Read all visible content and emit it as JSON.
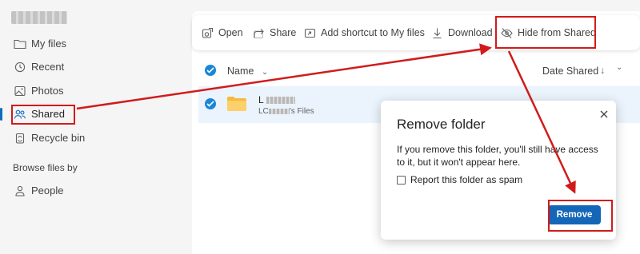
{
  "sidebar": {
    "user_name": "",
    "items": [
      {
        "label": "My files",
        "icon": "folder-icon"
      },
      {
        "label": "Recent",
        "icon": "clock-icon"
      },
      {
        "label": "Photos",
        "icon": "image-icon"
      },
      {
        "label": "Shared",
        "icon": "people-icon"
      },
      {
        "label": "Recycle bin",
        "icon": "trash-icon"
      }
    ],
    "browse_heading": "Browse files by",
    "browse_items": [
      {
        "label": "People",
        "icon": "person-icon"
      }
    ]
  },
  "toolbar": {
    "open": "Open",
    "share": "Share",
    "add_shortcut": "Add shortcut to My files",
    "download": "Download",
    "hide_shared": "Hide from Shared"
  },
  "list": {
    "name_header": "Name",
    "date_header": "Date Shared",
    "rows": [
      {
        "name_prefix": "L",
        "owner_prefix": "LC",
        "owner_suffix": "'s Files"
      }
    ]
  },
  "dialog": {
    "title": "Remove folder",
    "body": "If you remove this folder, you'll still have access to it, but it won't appear here.",
    "checkbox_label": "Report this folder as spam",
    "remove_button": "Remove"
  },
  "colors": {
    "accent": "#0f6cbd",
    "button": "#1466b8",
    "annotation": "#d11b1b",
    "selected_row": "#ebf3fc"
  }
}
